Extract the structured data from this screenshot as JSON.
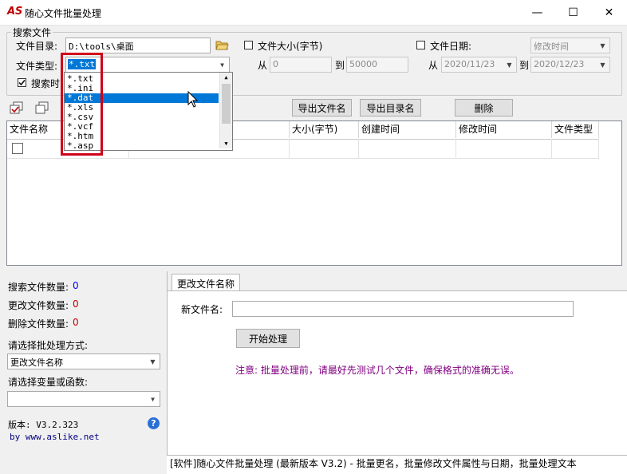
{
  "window": {
    "logo": "AS",
    "title": "随心文件批量处理",
    "controls": {
      "minimize": "—",
      "maximize": "☐",
      "close": "✕"
    }
  },
  "search": {
    "group_label": "搜索文件",
    "dir_label": "文件目录:",
    "dir_value": "D:\\tools\\桌面",
    "type_label": "文件类型:",
    "type_value": "*.txt",
    "type_options": [
      "*.txt",
      "*.ini",
      "*.dat",
      "*.xls",
      "*.csv",
      "*.vcf",
      "*.htm",
      "*.asp"
    ],
    "type_highlighted": "*.dat",
    "search_time_label": "搜索时",
    "search_time_checked": true,
    "size_label": "文件大小(字节)",
    "size_checked": false,
    "from_label": "从",
    "to_label": "到",
    "size_from": "0",
    "size_to": "50000",
    "date_label": "文件日期:",
    "date_checked": false,
    "date_kind": "修改时间",
    "date_from": "2020/11/23",
    "date_to": "2020/12/23"
  },
  "toolbar": {
    "export_names": "导出文件名",
    "export_dirs": "导出目录名",
    "delete": "删除"
  },
  "grid": {
    "columns": [
      "文件名称",
      "大小(字节)",
      "创建时间",
      "修改时间",
      "文件类型"
    ]
  },
  "stats": {
    "searched_label": "搜索文件数量:",
    "searched_value": "0",
    "changed_label": "更改文件数量:",
    "changed_value": "0",
    "deleted_label": "删除文件数量:",
    "deleted_value": "0",
    "method_label": "请选择批处理方式:",
    "method_value": "更改文件名称",
    "var_label": "请选择变量或函数:",
    "var_value": "",
    "version": "版本: V3.2.323",
    "by": "by www.aslike.net",
    "help_icon": "?"
  },
  "panel": {
    "tab": "更改文件名称",
    "new_name_label": "新文件名:",
    "new_name_value": "",
    "start_button": "开始处理",
    "notice": "注意: 批量处理前，请最好先测试几个文件，确保格式的准确无误。"
  },
  "statusbar": {
    "text": "[软件]随心文件批量处理 (最新版本 V3.2) - 批量更名，批量修改文件属性与日期，批量处理文本"
  },
  "colors": {
    "highlight": "#0078d7",
    "annotation": "#d0021b",
    "notice": "#800080",
    "count_blue": "#0000ff",
    "count_red": "#c00000"
  }
}
